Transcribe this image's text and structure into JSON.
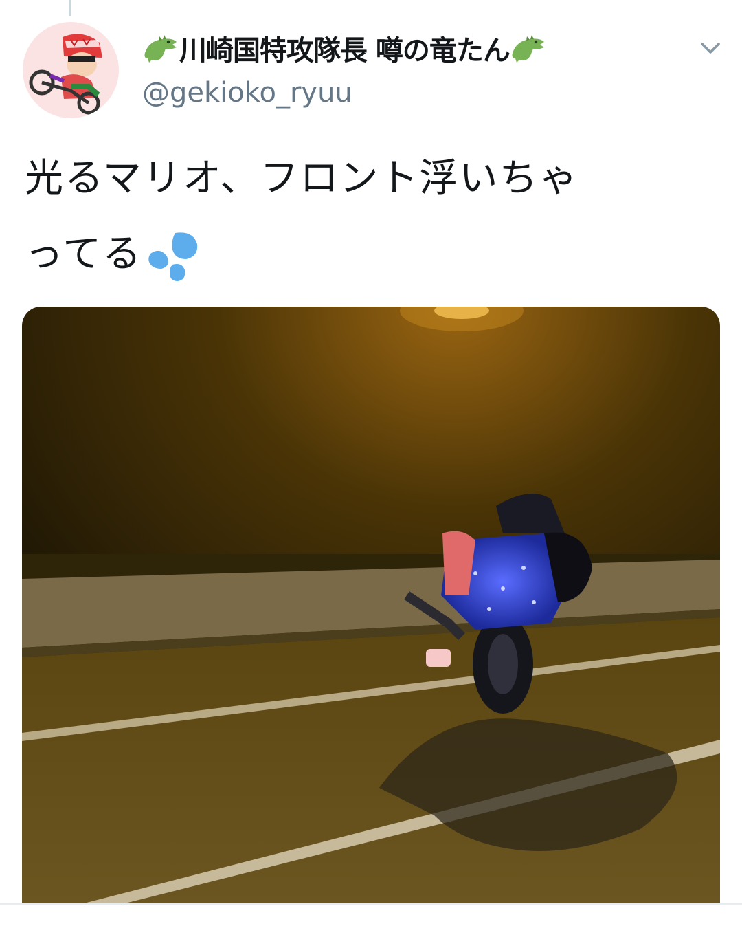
{
  "tweet": {
    "author": {
      "display_name": "川崎国特攻隊長 噂の竜たん",
      "handle": "@gekioko_ryuu",
      "name_prefix_icon": "crocodile-icon",
      "name_suffix_icon": "crocodile-icon",
      "avatar_icon": "avatar-biker-illustration"
    },
    "menu_icon": "chevron-down-icon",
    "text": "光るマリオ、フロント浮いちゃってる",
    "text_line_1": "光るマリオ、フロント浮いちゃ",
    "text_line_2": "ってる",
    "text_emoji": "sweat-droplets-icon",
    "media": {
      "type": "video-frame",
      "description_icon": "motorcycle-wheelie-night-scene"
    }
  },
  "colors": {
    "name": "#14171a",
    "handle": "#657786",
    "sweat": "#5dadec",
    "crocodile": "#77b255"
  }
}
